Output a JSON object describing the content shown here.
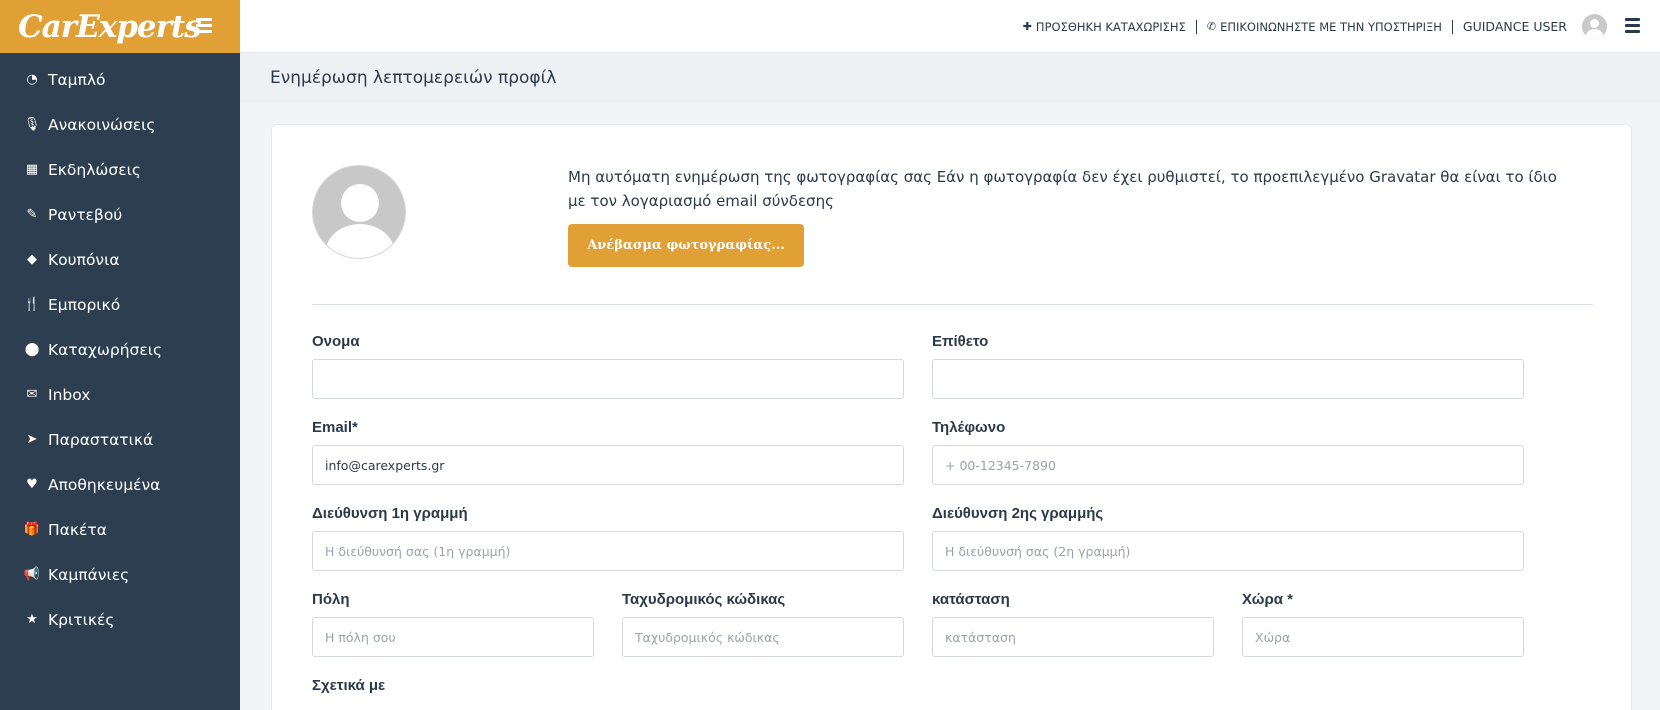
{
  "brand": {
    "logo_text": "CarExperts",
    "accent": "#e0a035",
    "sidebar_bg": "#2c3e50"
  },
  "sidebar": {
    "items": [
      {
        "label": "Ταμπλό",
        "icon": "dashboard-icon"
      },
      {
        "label": "Ανακοινώσεις",
        "icon": "microphone-icon"
      },
      {
        "label": "Εκδηλώσεις",
        "icon": "calendar-icon"
      },
      {
        "label": "Ραντεβού",
        "icon": "edit-icon"
      },
      {
        "label": "Κουπόνια",
        "icon": "tags-icon"
      },
      {
        "label": "Εμπορικό",
        "icon": "cutlery-icon"
      },
      {
        "label": "Καταχωρήσεις",
        "icon": "map-marker-icon"
      },
      {
        "label": "Inbox",
        "icon": "envelope-icon"
      },
      {
        "label": "Παραστατικά",
        "icon": "paper-plane-icon"
      },
      {
        "label": "Αποθηκευμένα",
        "icon": "heart-icon"
      },
      {
        "label": "Πακέτα",
        "icon": "gift-icon"
      },
      {
        "label": "Καμπάνιες",
        "icon": "bullhorn-icon"
      },
      {
        "label": "Κριτικές",
        "icon": "star-icon"
      }
    ]
  },
  "topbar": {
    "add_listing": "ΠΡΟΣΘΗΚΗ ΚΑΤΑΧΩΡΙΣΗΣ",
    "contact_support": "ΕΠΙΚΟΙΝΩΝΗΣΤΕ ΜΕ ΤΗΝ ΥΠΟΣΤΗΡΙΞΗ",
    "user_name": "GUIDANCE USER"
  },
  "page": {
    "title": "Ενημέρωση λεπτομερειών προφίλ"
  },
  "photo": {
    "text": "Μη αυτόματη ενημέρωση της φωτογραφίας σας Εάν η φωτογραφία δεν έχει ρυθμιστεί, το προεπιλεγμένο Gravatar θα είναι το ίδιο με τον λογαριασμό email σύνδεσης",
    "upload_label": "Ανέβασμα φωτογραφίας..."
  },
  "form": {
    "first_name": {
      "label": "Ονομα",
      "value": "",
      "placeholder": ""
    },
    "last_name": {
      "label": "Επίθετο",
      "value": "",
      "placeholder": ""
    },
    "email": {
      "label": "Email*",
      "value": "info@carexperts.gr",
      "placeholder": ""
    },
    "phone": {
      "label": "Τηλέφωνο",
      "value": "",
      "placeholder": "+ 00-12345-7890"
    },
    "address1": {
      "label": "Διεύθυνση 1η γραμμή",
      "value": "",
      "placeholder": "Η διεύθυνσή σας (1η γραμμή)"
    },
    "address2": {
      "label": "Διεύθυνση 2ης γραμμής",
      "value": "",
      "placeholder": "Η διεύθυνσή σας (2η γραμμή)"
    },
    "city": {
      "label": "Πόλη",
      "value": "",
      "placeholder": "Η πόλη σου"
    },
    "postal_code": {
      "label": "Ταχυδρομικός κώδικας",
      "value": "",
      "placeholder": "Ταχυδρομικός κώδικας"
    },
    "state": {
      "label": "κατάσταση",
      "value": "",
      "placeholder": "κατάσταση"
    },
    "country": {
      "label": "Χώρα *",
      "value": "",
      "placeholder": "Χώρα"
    },
    "about": {
      "label": "Σχετικά με"
    }
  }
}
